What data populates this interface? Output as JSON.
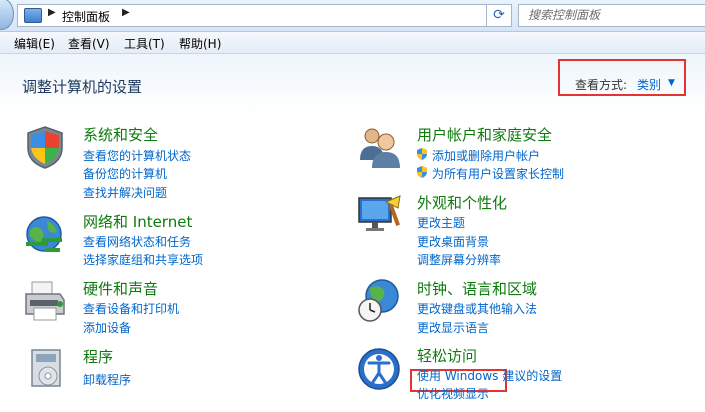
{
  "address_bar": {
    "breadcrumb": "控制面板",
    "search_placeholder": "搜索控制面板"
  },
  "menu": {
    "items": [
      "编辑(E)",
      "查看(V)",
      "工具(T)",
      "帮助(H)"
    ]
  },
  "header": {
    "title": "调整计算机的设置",
    "view_by_label": "查看方式:",
    "view_by_value": "类别"
  },
  "categories_left": [
    {
      "title": "系统和安全",
      "links": [
        "查看您的计算机状态",
        "备份您的计算机",
        "查找并解决问题"
      ]
    },
    {
      "title": "网络和 Internet",
      "links": [
        "查看网络状态和任务",
        "选择家庭组和共享选项"
      ]
    },
    {
      "title": "硬件和声音",
      "links": [
        "查看设备和打印机",
        "添加设备"
      ]
    },
    {
      "title": "程序",
      "links": [
        "卸载程序"
      ]
    }
  ],
  "categories_right": [
    {
      "title": "用户帐户和家庭安全",
      "links": [
        "添加或删除用户帐户",
        "为所有用户设置家长控制"
      ]
    },
    {
      "title": "外观和个性化",
      "links": [
        "更改主题",
        "更改桌面背景",
        "调整屏幕分辨率"
      ]
    },
    {
      "title": "时钟、语言和区域",
      "links": [
        "更改键盘或其他输入法",
        "更改显示语言"
      ]
    },
    {
      "title": "轻松访问",
      "links": [
        "使用 Windows 建议的设置",
        "优化视频显示"
      ]
    }
  ]
}
